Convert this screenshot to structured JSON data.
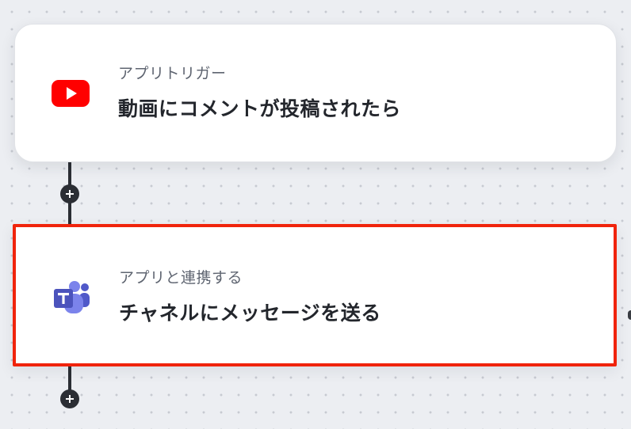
{
  "flow": {
    "trigger": {
      "kind": "アプリトリガー",
      "title": "動画にコメントが投稿されたら",
      "icon": "youtube-icon",
      "icon_color": "#ff0000"
    },
    "action": {
      "kind": "アプリと連携する",
      "title": "チャネルにメッセージを送る",
      "icon": "microsoft-teams-icon",
      "icon_color": "#5059c9",
      "highlight_color": "#f0240c"
    },
    "add_step_icon": "plus-icon",
    "connector_color": "#2b2e34"
  }
}
